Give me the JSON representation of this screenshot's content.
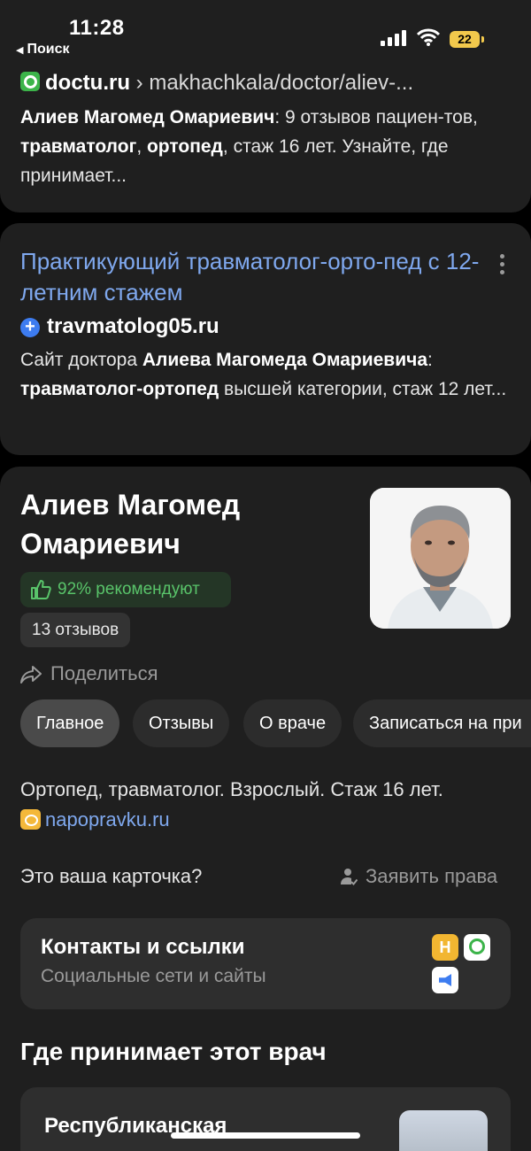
{
  "status_bar": {
    "time": "11:28",
    "back_app": "Поиск",
    "battery": "22",
    "battery_color": "#f2c94c"
  },
  "result1": {
    "host": "doctu.ru",
    "path": "› makhachkala/doctor/aliev-...",
    "snippet_parts": [
      {
        "text": "Алиев Магомед Омариевич",
        "bold": true
      },
      {
        "text": ": 9 отзывов пациен-тов, ",
        "bold": false
      },
      {
        "text": "травматолог",
        "bold": true
      },
      {
        "text": ", ",
        "bold": false
      },
      {
        "text": "ортопед",
        "bold": true
      },
      {
        "text": ", стаж 16 лет. Узнайте, где принимает...",
        "bold": false
      }
    ]
  },
  "result2": {
    "title": "Практикующий травматолог-орто-пед с 12-летним стажем",
    "source": "travmatolog05.ru",
    "snippet_parts": [
      {
        "text": "Сайт доктора ",
        "bold": false
      },
      {
        "text": "Алиева Магомеда Омариевича",
        "bold": true
      },
      {
        "text": ": ",
        "bold": false
      },
      {
        "text": "травматолог-ортопед",
        "bold": true
      },
      {
        "text": " высшей категории, стаж 12 лет...",
        "bold": false
      }
    ]
  },
  "doctor": {
    "name": "Алиев Магомед Омариевич",
    "recommend": "92% рекомендуют",
    "reviews": "13 отзывов",
    "share": "Поделиться",
    "tabs": [
      {
        "label": "Главное",
        "active": true
      },
      {
        "label": "Отзывы",
        "active": false
      },
      {
        "label": "О враче",
        "active": false
      },
      {
        "label": "Записаться на при",
        "active": false
      }
    ],
    "description": "Ортопед, травматолог. Взрослый. Стаж 16 лет.",
    "source_link": "napopravku.ru",
    "own_card_question": "Это ваша карточка?",
    "claim": "Заявить права"
  },
  "contacts": {
    "title": "Контакты и ссылки",
    "subtitle": "Социальные сети и сайты",
    "badge_letter": "Н"
  },
  "where": {
    "title": "Где принимает этот врач",
    "clinic_name": "Республиканская"
  },
  "colors": {
    "link": "#7fa8ee",
    "recommend": "#59c46a",
    "card_bg": "#1f1f1f"
  }
}
